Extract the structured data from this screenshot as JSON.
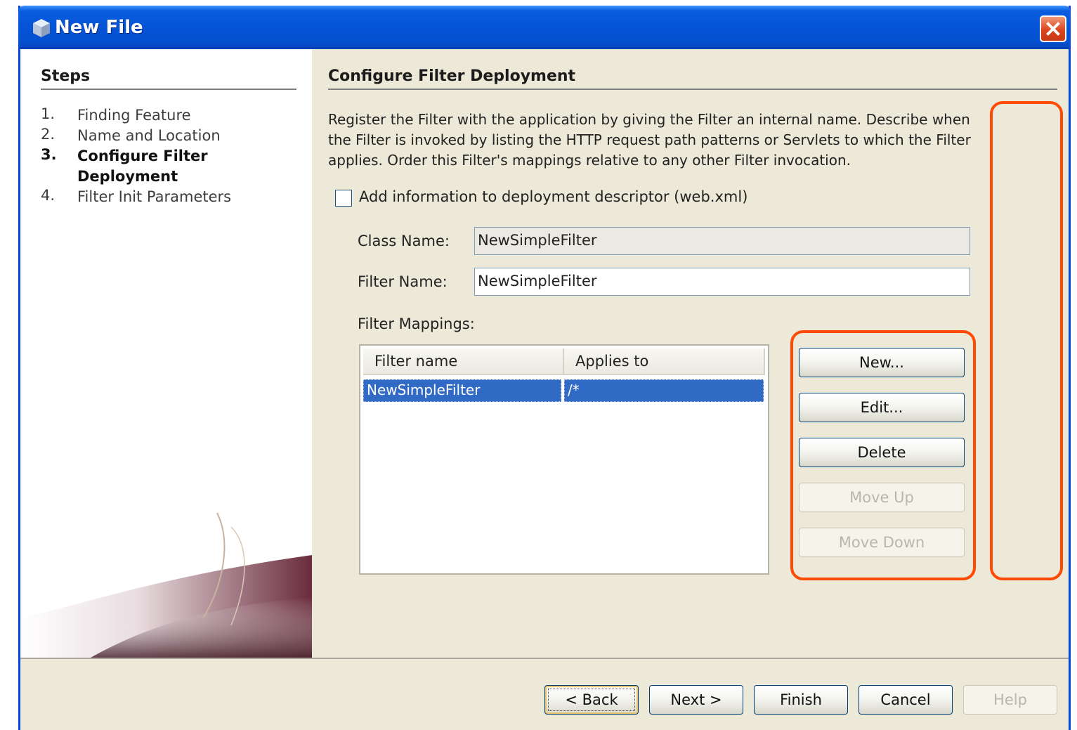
{
  "window": {
    "title": "New File",
    "title_icon": "cube-icon",
    "close_icon": "close-icon"
  },
  "steps": {
    "title": "Steps",
    "items": [
      {
        "number": "1.",
        "label": "Finding Feature",
        "active": false
      },
      {
        "number": "2.",
        "label": "Name and Location",
        "active": false
      },
      {
        "number": "3.",
        "label": "Configure Filter Deployment",
        "active": true
      },
      {
        "number": "4.",
        "label": "Filter Init Parameters",
        "active": false
      }
    ]
  },
  "panel": {
    "title": "Configure Filter Deployment",
    "description": "Register the Filter with the application by giving the Filter an internal name. Describe when the Filter is invoked by listing the HTTP request path patterns or Servlets to which the Filter applies. Order this Filter's mappings relative to any other Filter invocation.",
    "checkbox_label": "Add information to deployment descriptor (web.xml)",
    "checkbox_checked": false,
    "class_name_label": "Class Name:",
    "class_name_value": "NewSimpleFilter",
    "filter_name_label": "Filter Name:",
    "filter_name_value": "NewSimpleFilter",
    "mappings_label": "Filter Mappings:"
  },
  "mappings_table": {
    "columns": [
      "Filter name",
      "Applies to"
    ],
    "rows": [
      {
        "filter_name": "NewSimpleFilter",
        "applies_to": "/*",
        "selected": true
      }
    ]
  },
  "mapping_buttons": {
    "new": "New...",
    "edit": "Edit...",
    "delete": "Delete",
    "move_up": "Move Up",
    "move_down": "Move Down"
  },
  "footer_buttons": {
    "back": "< Back",
    "next": "Next >",
    "finish": "Finish",
    "cancel": "Cancel",
    "help": "Help"
  },
  "colors": {
    "annotation": "#ff4a06",
    "title_bar": "#0553d6",
    "selection": "#316ac5"
  }
}
